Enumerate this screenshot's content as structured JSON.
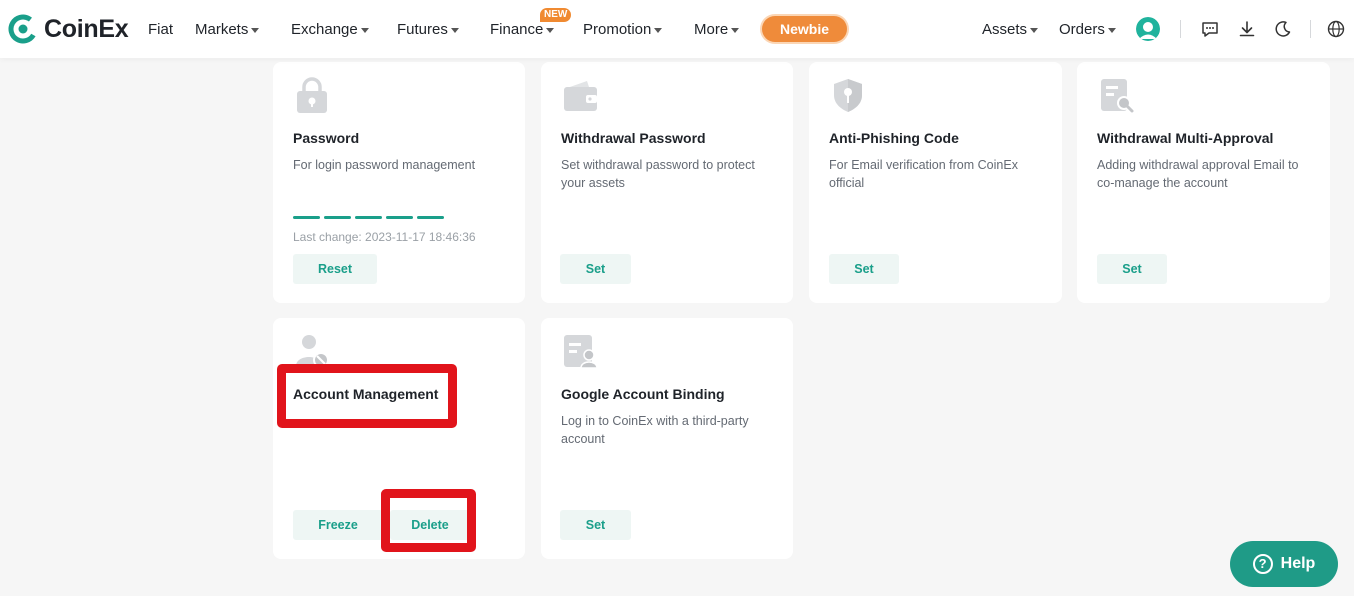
{
  "brand": {
    "name": "CoinEx",
    "accent": "#1a9f8a",
    "highlight": "#e1141b",
    "orange": "#ef8b3a"
  },
  "nav": {
    "items": [
      {
        "label": "Fiat",
        "dropdown": false
      },
      {
        "label": "Markets",
        "dropdown": true
      },
      {
        "label": "Exchange",
        "dropdown": true
      },
      {
        "label": "Futures",
        "dropdown": true
      },
      {
        "label": "Finance",
        "dropdown": true,
        "badge": "NEW"
      },
      {
        "label": "Promotion",
        "dropdown": true
      },
      {
        "label": "More",
        "dropdown": true
      }
    ],
    "newbie_label": "Newbie",
    "assets_label": "Assets",
    "orders_label": "Orders",
    "icons": [
      "avatar-icon",
      "chat-icon",
      "download-icon",
      "moon-icon",
      "globe-icon"
    ]
  },
  "cards": [
    {
      "icon": "lock-icon",
      "title": "Password",
      "desc": "For login password management",
      "strength_segments": 5,
      "last_change": "Last change: 2023-11-17 18:46:36",
      "buttons": [
        "Reset"
      ]
    },
    {
      "icon": "wallet-icon",
      "title": "Withdrawal Password",
      "desc": "Set withdrawal password to protect your assets",
      "buttons": [
        "Set"
      ]
    },
    {
      "icon": "shield-key-icon",
      "title": "Anti-Phishing Code",
      "desc": "For Email verification from CoinEx official",
      "buttons": [
        "Set"
      ]
    },
    {
      "icon": "document-search-icon",
      "title": "Withdrawal Multi-Approval",
      "desc": "Adding withdrawal approval Email to co-manage the account",
      "buttons": [
        "Set"
      ]
    },
    {
      "icon": "user-block-icon",
      "title": "Account Management",
      "desc": "",
      "buttons": [
        "Freeze",
        "Delete"
      ]
    },
    {
      "icon": "id-card-user-icon",
      "title": "Google Account Binding",
      "desc": "Log in to CoinEx with a third-party account",
      "buttons": [
        "Set"
      ]
    }
  ],
  "help_label": "Help",
  "help_icon": "?"
}
